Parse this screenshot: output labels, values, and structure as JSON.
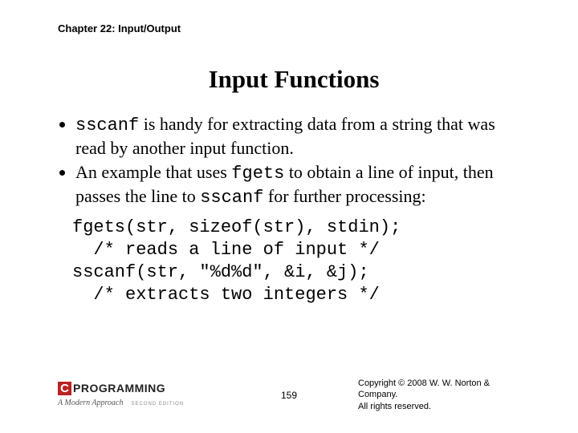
{
  "chapter": "Chapter 22: Input/Output",
  "title": "Input Functions",
  "bullet1": {
    "code1": "sscanf",
    "t1": " is handy for extracting data from a string that was read by another input function."
  },
  "bullet2": {
    "t1": "An example that uses ",
    "code1": "fgets",
    "t2": " to obtain a line of input, then passes the line to ",
    "code2": "sscanf",
    "t3": " for further processing:"
  },
  "code": "fgets(str, sizeof(str), stdin);\n  /* reads a line of input */\nsscanf(str, \"%d%d\", &i, &j);\n  /* extracts two integers */",
  "logo": {
    "c": "C",
    "text": "PROGRAMMING",
    "sub": "A Modern Approach",
    "ed": "SECOND EDITION"
  },
  "page": "159",
  "copyright": "Copyright © 2008 W. W. Norton & Company.\nAll rights reserved."
}
